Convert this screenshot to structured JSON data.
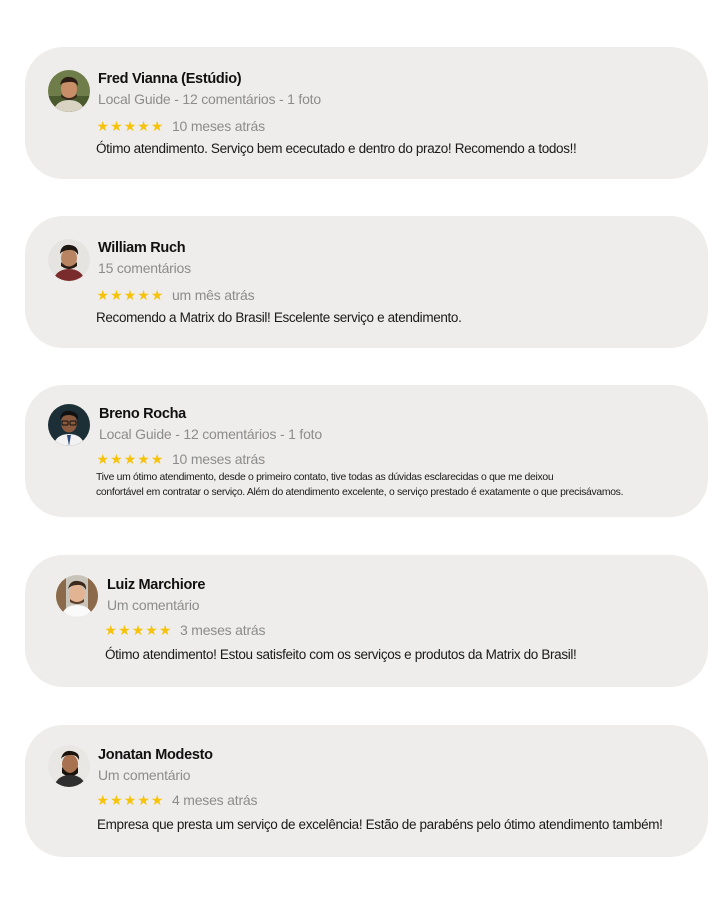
{
  "reviews": [
    {
      "name": "Fred Vianna (Estúdio)",
      "meta": "Local Guide - 12 comentários - 1 foto",
      "stars": 5,
      "date": "10 meses atrás",
      "text": "Ótimo atendimento. Serviço bem ececutado e dentro  do prazo! Recomendo a todos!!",
      "avatar_icon": "person-avatar-icon"
    },
    {
      "name": "William Ruch",
      "meta": "15 comentários",
      "stars": 5,
      "date": "um mês atrás",
      "text": "Recomendo a Matrix do Brasil! Escelente serviço e atendimento.",
      "avatar_icon": "person-avatar-icon"
    },
    {
      "name": "Breno Rocha",
      "meta": "Local Guide - 12 comentários - 1 foto",
      "stars": 5,
      "date": "10 meses atrás",
      "text_line1": "Tive um ótimo atendimento, desde o primeiro contato, tive todas as dúvidas esclarecidas o que me deixou",
      "text_line2": "confortável em contratar o serviço. Além do atendimento excelente, o serviço prestado é exatamente o que precisávamos.",
      "avatar_icon": "person-avatar-icon"
    },
    {
      "name": "Luiz Marchiore",
      "meta": "Um comentário",
      "stars": 5,
      "date": "3 meses atrás",
      "text": "Ótimo atendimento! Estou satisfeito com os serviços e produtos da Matrix do Brasil!",
      "avatar_icon": "person-avatar-icon"
    },
    {
      "name": "Jonatan Modesto",
      "meta": "Um comentário",
      "stars": 5,
      "date": "4 meses atrás",
      "text": "Empresa que presta um serviço de excelência! Estão de parabéns pelo ótimo atendimento também!",
      "avatar_icon": "person-avatar-icon"
    }
  ],
  "star_glyph": "★",
  "colors": {
    "card_bg": "#efedeb",
    "star": "#f6c20a",
    "meta": "#8c8c8c"
  }
}
